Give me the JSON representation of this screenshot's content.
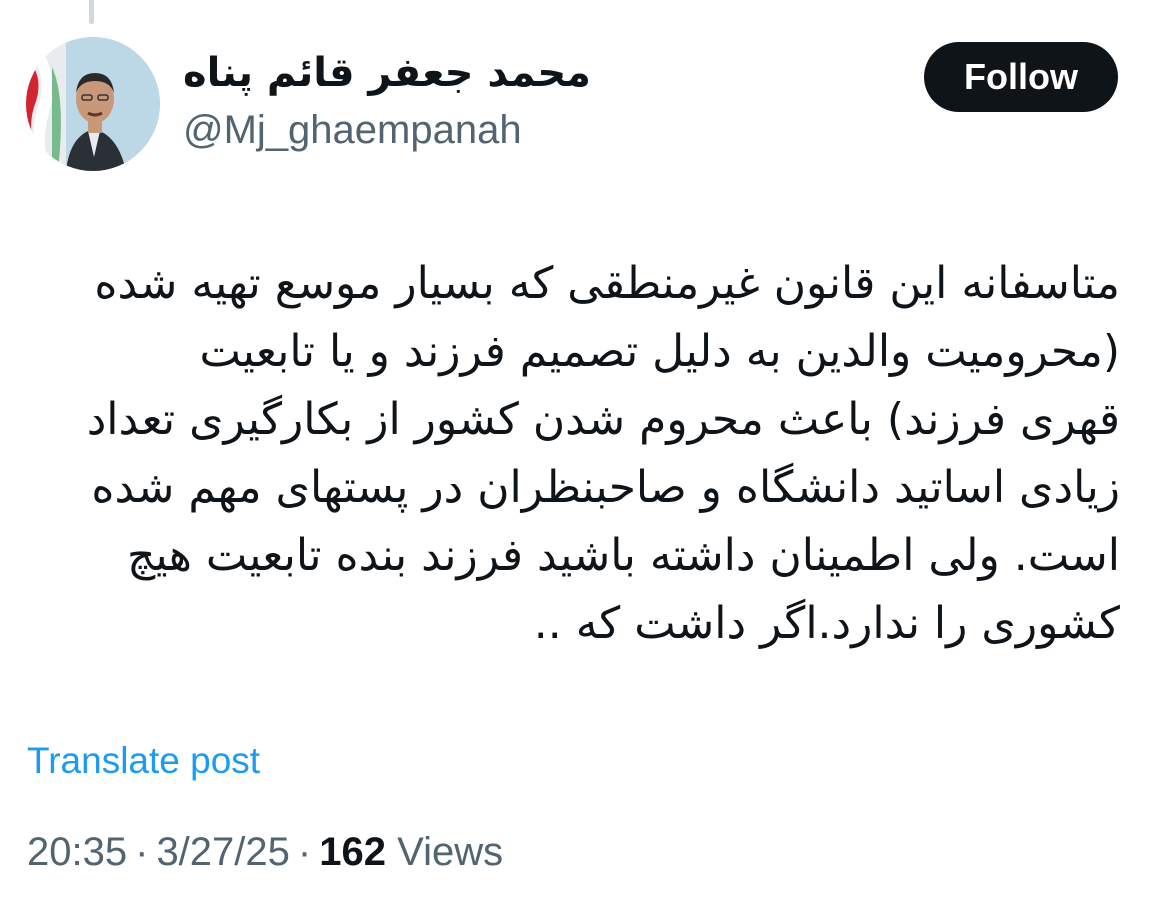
{
  "author": {
    "display_name": "محمد جعفر قائم پناه",
    "handle": "@Mj_ghaempanah"
  },
  "follow_button": {
    "label": "Follow"
  },
  "tweet": {
    "lines": [
      "متاسفانه این قانون غیرمنطقی که بسیار موسع تهیه شده",
      "(محرومیت والدین به دلیل تصمیم فرزند و یا تابعیت",
      "قهری فرزند) باعث محروم شدن کشور از بکارگیری تعداد",
      "زیادی اساتید دانشگاه و صاحبنظران در پستهای مهم شده",
      "است. ولی اطمینان داشته باشید فرزند بنده تابعیت هیچ",
      "کشوری را ندارد.اگر داشت که .."
    ]
  },
  "translate": {
    "label": "Translate post"
  },
  "meta": {
    "time": "20:35",
    "date": "3/27/25",
    "separator": "·",
    "views_count": "162",
    "views_label": "Views"
  },
  "colors": {
    "text": "#0f1419",
    "secondary": "#536471",
    "link": "#1d9bf0",
    "button_bg": "#0f1419"
  }
}
